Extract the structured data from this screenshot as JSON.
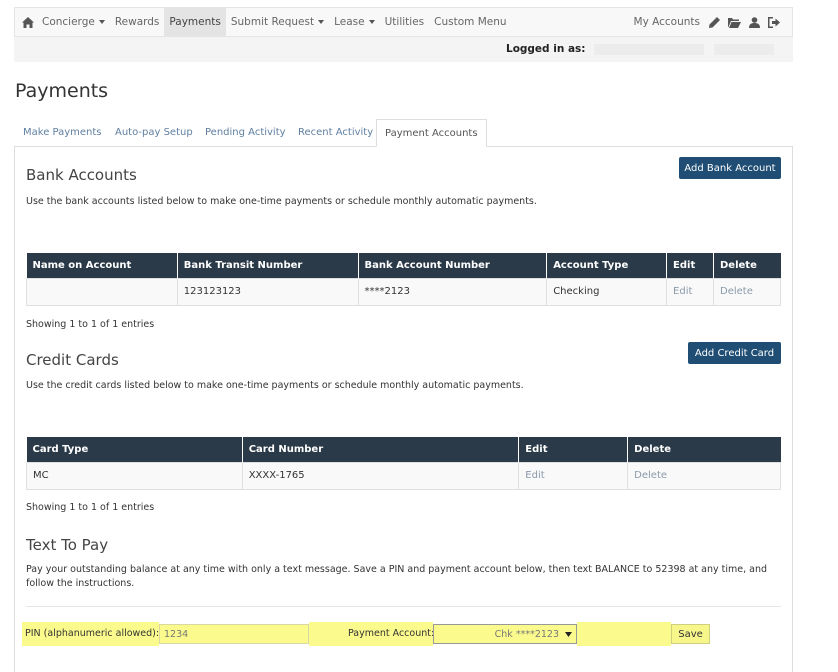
{
  "nav": {
    "items": [
      {
        "label": "Concierge",
        "dropdown": true
      },
      {
        "label": "Rewards",
        "dropdown": false
      },
      {
        "label": "Payments",
        "dropdown": false,
        "active": true
      },
      {
        "label": "Submit Request",
        "dropdown": true
      },
      {
        "label": "Lease",
        "dropdown": true
      },
      {
        "label": "Utilities",
        "dropdown": false
      },
      {
        "label": "Custom Menu",
        "dropdown": false
      }
    ],
    "my_accounts": "My Accounts",
    "icons": [
      "home-icon",
      "pencil-icon",
      "folder-open-icon",
      "user-icon",
      "sign-out-icon"
    ]
  },
  "logged_in_label": "Logged in as:",
  "page_title": "Payments",
  "tabs": [
    "Make Payments",
    "Auto-pay Setup",
    "Pending Activity",
    "Recent Activity",
    "Payment Accounts"
  ],
  "bank": {
    "title": "Bank Accounts",
    "description": "Use the bank accounts listed below to make one-time payments or schedule monthly automatic payments.",
    "add_button": "Add Bank Account",
    "headers": [
      "Name on Account",
      "Bank Transit Number",
      "Bank Account Number",
      "Account Type",
      "Edit",
      "Delete"
    ],
    "rows": [
      [
        "",
        "123123123",
        "****2123",
        "Checking",
        "Edit",
        "Delete"
      ]
    ],
    "showing": "Showing 1 to 1 of 1 entries"
  },
  "card": {
    "title": "Credit Cards",
    "description": "Use the credit cards listed below to make one-time payments or schedule monthly automatic payments.",
    "add_button": "Add Credit Card",
    "headers": [
      "Card Type",
      "Card Number",
      "Edit",
      "Delete"
    ],
    "rows": [
      [
        "MC",
        "XXXX-1765",
        "Edit",
        "Delete"
      ]
    ],
    "showing": "Showing 1 to 1 of 1 entries"
  },
  "text_to_pay": {
    "title": "Text To Pay",
    "description": "Pay your outstanding balance at any time with only a text message. Save a PIN and payment account below, then text BALANCE to 52398 at any time, and follow the instructions.",
    "pin_label": "PIN (alphanumeric allowed):",
    "pin_value": "1234",
    "account_label": "Payment Account:",
    "account_value": "Chk ****2123",
    "save_label": "Save"
  },
  "colors": {
    "primary": "#1f4d73",
    "table_header": "#2b3a48",
    "highlight": "#fbfb8d"
  }
}
